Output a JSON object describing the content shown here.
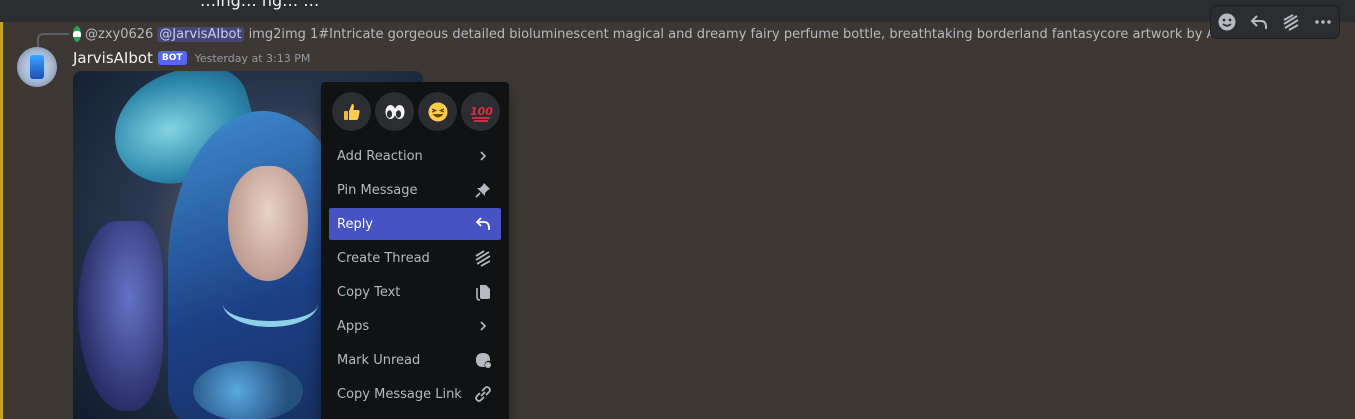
{
  "header": {
    "partial_text": "…ing… ng… …"
  },
  "reply_reference": {
    "user": "@zxy0626",
    "mention": "@JarvisAIbot",
    "text": "img2img 1#Intricate gorgeous detailed bioluminescent magical and dreamy fairy perfume bottle, breathtaking borderland fantasycore artwork by Android Jones, Jean Bap"
  },
  "message": {
    "author": "JarvisAIbot",
    "bot_tag": "BOT",
    "timestamp": "Yesterday at 3:13 PM"
  },
  "hover_actions": [
    {
      "name": "add-reaction-icon",
      "label": "Add Reaction"
    },
    {
      "name": "reply-icon",
      "label": "Reply"
    },
    {
      "name": "thread-icon",
      "label": "Create Thread"
    },
    {
      "name": "more-icon",
      "label": "More"
    }
  ],
  "context_menu": {
    "quick_reactions": [
      "👍",
      "👀",
      "😆",
      "💯"
    ],
    "items": [
      {
        "label": "Add Reaction",
        "icon": "chevron-right-icon",
        "active": false
      },
      {
        "label": "Pin Message",
        "icon": "pin-icon",
        "active": false
      },
      {
        "label": "Reply",
        "icon": "reply-icon",
        "active": true
      },
      {
        "label": "Create Thread",
        "icon": "thread-icon",
        "active": false
      },
      {
        "label": "Copy Text",
        "icon": "copy-icon",
        "active": false
      },
      {
        "label": "Apps",
        "icon": "chevron-right-icon",
        "active": false
      },
      {
        "label": "Mark Unread",
        "icon": "mark-unread-icon",
        "active": false
      },
      {
        "label": "Copy Message Link",
        "icon": "link-icon",
        "active": false
      }
    ]
  },
  "colors": {
    "background": "#3d3833",
    "menu_background": "#111214",
    "active_item": "#4752c4",
    "bot_tag": "#5865f2",
    "highlight_bar": "#c8a41a"
  }
}
